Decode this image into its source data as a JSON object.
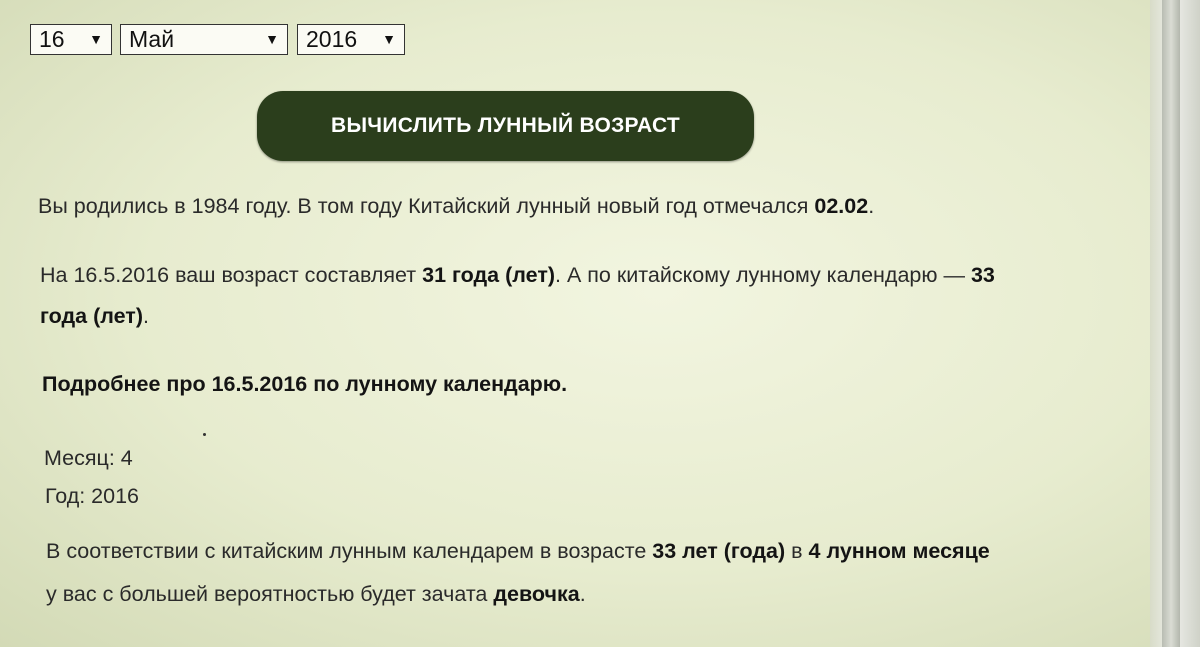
{
  "selects": {
    "day": "16",
    "month": "Май",
    "year": "2016",
    "arrow": "▼"
  },
  "button": {
    "label": "ВЫЧИСЛИТЬ ЛУННЫЙ ВОЗРАСТ"
  },
  "result": {
    "born_text": "Вы родились в 1984 году. В том году Китайский лунный новый год отмечался ",
    "new_year_date": "02.02",
    "born_end": ".",
    "age_text_1": "На 16.5.2016 ваш возраст составляет ",
    "age_value": "31 года (лет)",
    "age_text_2": ". А по китайскому лунному календарю — ",
    "lunar_age_part1": "33",
    "lunar_age_part2": "года (лет)",
    "age_end": ".",
    "more_link": "Подробнее про 16.5.2016 по лунному календарю.",
    "month_label": "Месяц: 4",
    "year_label": "Год: 2016",
    "concl_text_1": "В соответствии с китайским лунным календарем в возрасте ",
    "concl_age": "33 лет (года)",
    "concl_text_2": " в ",
    "concl_month": "4 лунном месяце",
    "concl_text_3": "у вас с большей вероятностью будет зачата ",
    "concl_gender": "девочка",
    "concl_end": "."
  },
  "colors": {
    "button_bg": "#2b3e1c",
    "page_bg": "#e7eccf"
  }
}
